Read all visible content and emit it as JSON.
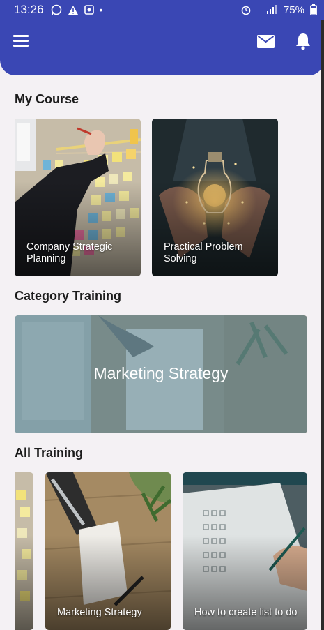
{
  "status_bar": {
    "time": "13:26",
    "battery": "75%"
  },
  "sections": {
    "my_course": "My Course",
    "category_training": "Category Training",
    "all_training": "All Training"
  },
  "my_course": [
    {
      "title": "Company Strategic Planning"
    },
    {
      "title": "Practical Problem Solving"
    }
  ],
  "category_training": {
    "title": "Marketing Strategy"
  },
  "all_training": [
    {
      "title": ""
    },
    {
      "title": "Marketing Strategy"
    },
    {
      "title": "How to create list to do"
    }
  ],
  "colors": {
    "primary": "#3a47b4",
    "background": "#f4f1f4"
  },
  "icons": [
    "menu-icon",
    "mail-icon",
    "bell-icon",
    "whatsapp-icon",
    "alarm-icon",
    "signal-icon",
    "battery-icon"
  ]
}
